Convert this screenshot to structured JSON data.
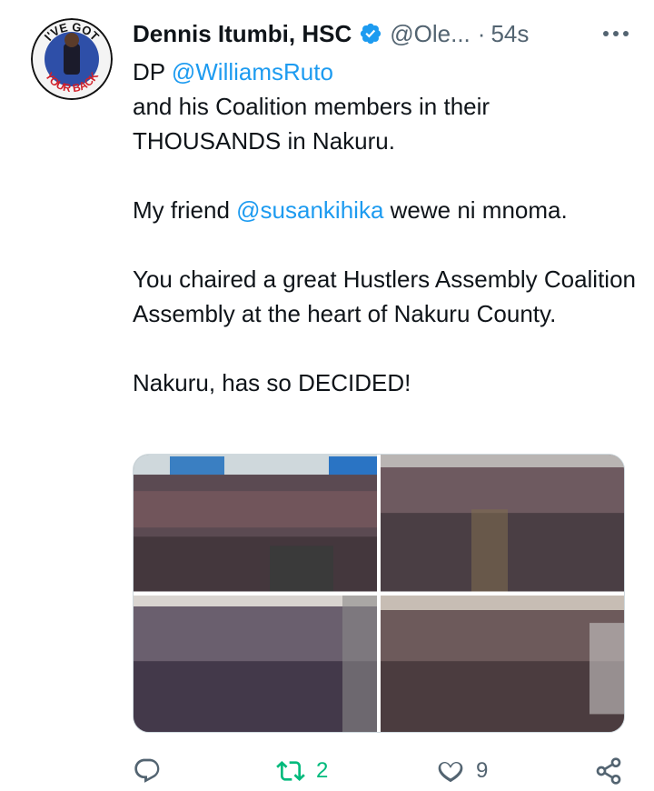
{
  "author": {
    "name": "Dennis Itumbi, HSC",
    "handle": "@Ole...",
    "separator": "·",
    "time": "54s",
    "avatar_text_top": "I'VE GOT",
    "avatar_text_bottom": "YOUR BACK"
  },
  "tweet": {
    "line1_prefix": "DP ",
    "mention1": "@WilliamsRuto",
    "line2": "and his Coalition members in their THOUSANDS in Nakuru.",
    "line3_prefix": "My friend ",
    "mention2": "@susankihika",
    "line3_suffix": " wewe ni mnoma.",
    "line4": "You chaired a great Hustlers Assembly Coalition Assembly at the heart of Nakuru County.",
    "line5": "Nakuru, has so DECIDED!"
  },
  "media": {
    "photos": [
      "crowd-photo-1",
      "crowd-photo-2",
      "crowd-photo-3",
      "crowd-photo-4"
    ]
  },
  "actions": {
    "reply_count": "",
    "retweet_count": "2",
    "like_count": "9"
  },
  "colors": {
    "accent": "#1d9bf0",
    "retweeted": "#00ba7c",
    "muted": "#536471"
  }
}
